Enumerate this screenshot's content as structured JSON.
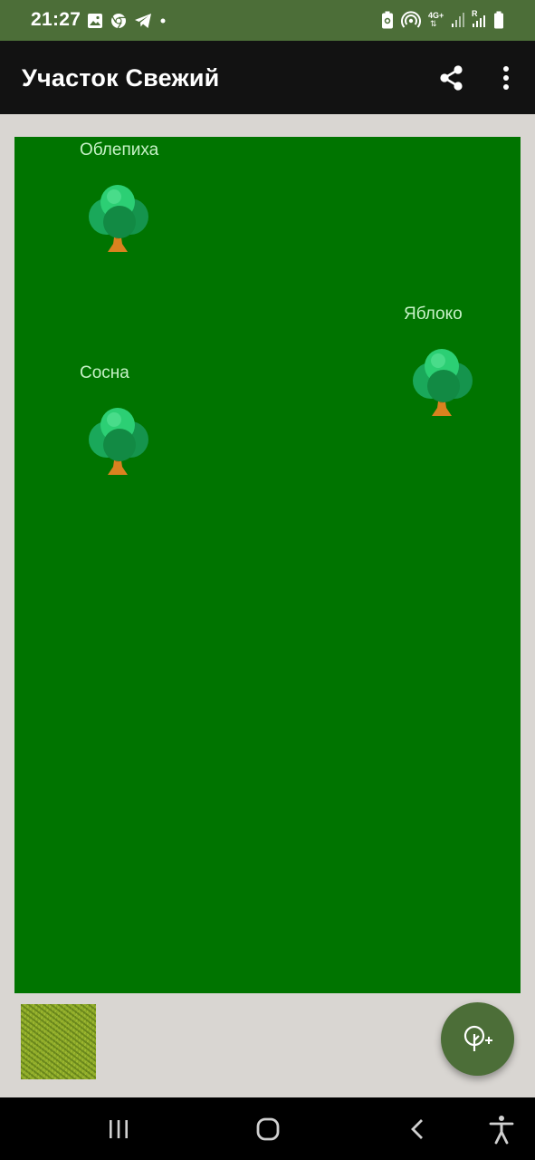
{
  "status_bar": {
    "time": "21:27",
    "left_icons": [
      "image-icon",
      "chrome-icon",
      "telegram-icon",
      "dot-icon"
    ],
    "right_icons": [
      "battery-saver-icon",
      "hotspot-icon",
      "network-4g-icon",
      "signal-icon",
      "signal-roaming-icon",
      "battery-icon"
    ],
    "network_label": "4G+",
    "roaming_label": "R"
  },
  "app_bar": {
    "title": "Участок Свежий",
    "actions": [
      "share-icon",
      "more-vert-icon"
    ]
  },
  "plot": {
    "background_color": "#007400",
    "plants": [
      {
        "name": "Облепиха",
        "icon": "tree-icon"
      },
      {
        "name": "Яблоко",
        "icon": "tree-icon"
      },
      {
        "name": "Сосна",
        "icon": "tree-icon"
      }
    ]
  },
  "ground_texture": {
    "icon": "grass-texture"
  },
  "fab": {
    "icon": "add-tree-icon",
    "color": "#4c6e38"
  },
  "nav_bar": {
    "buttons": [
      "recent-apps-icon",
      "home-icon",
      "back-icon",
      "accessibility-icon"
    ]
  }
}
